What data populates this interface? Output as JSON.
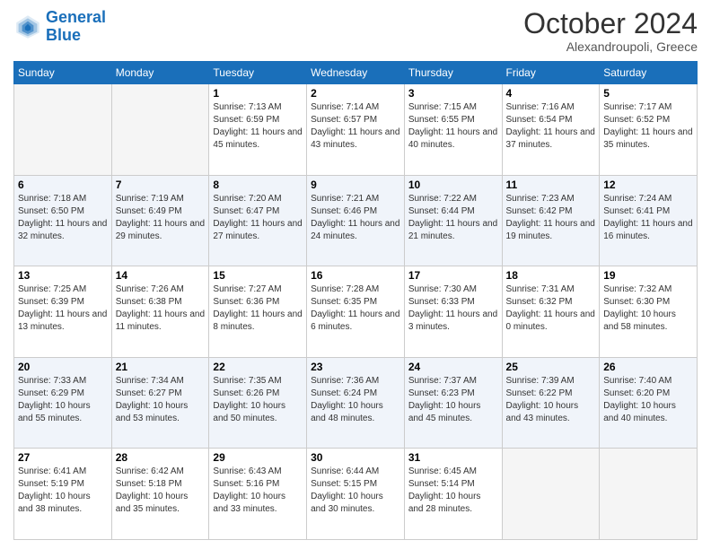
{
  "logo": {
    "line1": "General",
    "line2": "Blue"
  },
  "title": "October 2024",
  "location": "Alexandroupoli, Greece",
  "days_of_week": [
    "Sunday",
    "Monday",
    "Tuesday",
    "Wednesday",
    "Thursday",
    "Friday",
    "Saturday"
  ],
  "weeks": [
    [
      {
        "day": "",
        "info": ""
      },
      {
        "day": "",
        "info": ""
      },
      {
        "day": "1",
        "info": "Sunrise: 7:13 AM\nSunset: 6:59 PM\nDaylight: 11 hours and 45 minutes."
      },
      {
        "day": "2",
        "info": "Sunrise: 7:14 AM\nSunset: 6:57 PM\nDaylight: 11 hours and 43 minutes."
      },
      {
        "day": "3",
        "info": "Sunrise: 7:15 AM\nSunset: 6:55 PM\nDaylight: 11 hours and 40 minutes."
      },
      {
        "day": "4",
        "info": "Sunrise: 7:16 AM\nSunset: 6:54 PM\nDaylight: 11 hours and 37 minutes."
      },
      {
        "day": "5",
        "info": "Sunrise: 7:17 AM\nSunset: 6:52 PM\nDaylight: 11 hours and 35 minutes."
      }
    ],
    [
      {
        "day": "6",
        "info": "Sunrise: 7:18 AM\nSunset: 6:50 PM\nDaylight: 11 hours and 32 minutes."
      },
      {
        "day": "7",
        "info": "Sunrise: 7:19 AM\nSunset: 6:49 PM\nDaylight: 11 hours and 29 minutes."
      },
      {
        "day": "8",
        "info": "Sunrise: 7:20 AM\nSunset: 6:47 PM\nDaylight: 11 hours and 27 minutes."
      },
      {
        "day": "9",
        "info": "Sunrise: 7:21 AM\nSunset: 6:46 PM\nDaylight: 11 hours and 24 minutes."
      },
      {
        "day": "10",
        "info": "Sunrise: 7:22 AM\nSunset: 6:44 PM\nDaylight: 11 hours and 21 minutes."
      },
      {
        "day": "11",
        "info": "Sunrise: 7:23 AM\nSunset: 6:42 PM\nDaylight: 11 hours and 19 minutes."
      },
      {
        "day": "12",
        "info": "Sunrise: 7:24 AM\nSunset: 6:41 PM\nDaylight: 11 hours and 16 minutes."
      }
    ],
    [
      {
        "day": "13",
        "info": "Sunrise: 7:25 AM\nSunset: 6:39 PM\nDaylight: 11 hours and 13 minutes."
      },
      {
        "day": "14",
        "info": "Sunrise: 7:26 AM\nSunset: 6:38 PM\nDaylight: 11 hours and 11 minutes."
      },
      {
        "day": "15",
        "info": "Sunrise: 7:27 AM\nSunset: 6:36 PM\nDaylight: 11 hours and 8 minutes."
      },
      {
        "day": "16",
        "info": "Sunrise: 7:28 AM\nSunset: 6:35 PM\nDaylight: 11 hours and 6 minutes."
      },
      {
        "day": "17",
        "info": "Sunrise: 7:30 AM\nSunset: 6:33 PM\nDaylight: 11 hours and 3 minutes."
      },
      {
        "day": "18",
        "info": "Sunrise: 7:31 AM\nSunset: 6:32 PM\nDaylight: 11 hours and 0 minutes."
      },
      {
        "day": "19",
        "info": "Sunrise: 7:32 AM\nSunset: 6:30 PM\nDaylight: 10 hours and 58 minutes."
      }
    ],
    [
      {
        "day": "20",
        "info": "Sunrise: 7:33 AM\nSunset: 6:29 PM\nDaylight: 10 hours and 55 minutes."
      },
      {
        "day": "21",
        "info": "Sunrise: 7:34 AM\nSunset: 6:27 PM\nDaylight: 10 hours and 53 minutes."
      },
      {
        "day": "22",
        "info": "Sunrise: 7:35 AM\nSunset: 6:26 PM\nDaylight: 10 hours and 50 minutes."
      },
      {
        "day": "23",
        "info": "Sunrise: 7:36 AM\nSunset: 6:24 PM\nDaylight: 10 hours and 48 minutes."
      },
      {
        "day": "24",
        "info": "Sunrise: 7:37 AM\nSunset: 6:23 PM\nDaylight: 10 hours and 45 minutes."
      },
      {
        "day": "25",
        "info": "Sunrise: 7:39 AM\nSunset: 6:22 PM\nDaylight: 10 hours and 43 minutes."
      },
      {
        "day": "26",
        "info": "Sunrise: 7:40 AM\nSunset: 6:20 PM\nDaylight: 10 hours and 40 minutes."
      }
    ],
    [
      {
        "day": "27",
        "info": "Sunrise: 6:41 AM\nSunset: 5:19 PM\nDaylight: 10 hours and 38 minutes."
      },
      {
        "day": "28",
        "info": "Sunrise: 6:42 AM\nSunset: 5:18 PM\nDaylight: 10 hours and 35 minutes."
      },
      {
        "day": "29",
        "info": "Sunrise: 6:43 AM\nSunset: 5:16 PM\nDaylight: 10 hours and 33 minutes."
      },
      {
        "day": "30",
        "info": "Sunrise: 6:44 AM\nSunset: 5:15 PM\nDaylight: 10 hours and 30 minutes."
      },
      {
        "day": "31",
        "info": "Sunrise: 6:45 AM\nSunset: 5:14 PM\nDaylight: 10 hours and 28 minutes."
      },
      {
        "day": "",
        "info": ""
      },
      {
        "day": "",
        "info": ""
      }
    ]
  ]
}
